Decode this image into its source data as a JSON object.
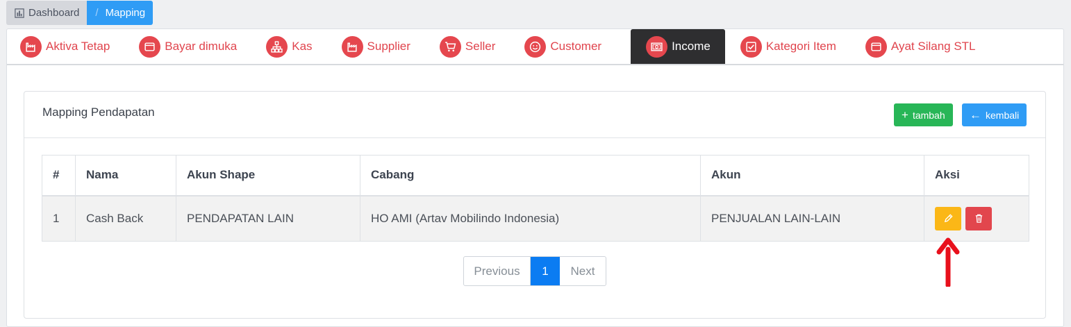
{
  "breadcrumb": {
    "home": "Dashboard",
    "separator": "/",
    "current": "Mapping"
  },
  "tabs": [
    {
      "label": "Aktiva Tetap",
      "icon": "factory-icon"
    },
    {
      "label": "Bayar dimuka",
      "icon": "wallet-icon"
    },
    {
      "label": "Kas",
      "icon": "sitemap-icon"
    },
    {
      "label": "Supplier",
      "icon": "factory-icon"
    },
    {
      "label": "Seller",
      "icon": "cart-icon"
    },
    {
      "label": "Customer",
      "icon": "smile-icon"
    },
    {
      "label": "Income",
      "icon": "money-icon",
      "active": true
    },
    {
      "label": "Kategori Item",
      "icon": "checkbox-icon"
    },
    {
      "label": "Ayat Silang STL",
      "icon": "wallet-icon"
    }
  ],
  "panel": {
    "title": "Mapping Pendapatan",
    "add_label": "tambah",
    "back_label": "kembali"
  },
  "table": {
    "headers": [
      "#",
      "Nama",
      "Akun Shape",
      "Cabang",
      "Akun",
      "Aksi"
    ],
    "rows": [
      {
        "no": "1",
        "nama": "Cash Back",
        "akun_shape": "PENDAPATAN LAIN",
        "cabang": "HO AMI (Artav Mobilindo Indonesia)",
        "akun": "PENJUALAN LAIN-LAIN"
      }
    ]
  },
  "pagination": {
    "prev": "Previous",
    "current": "1",
    "next": "Next"
  },
  "colors": {
    "tab_red": "#e0444d",
    "active_tab_bg": "#2e2e30",
    "add_green": "#28b657",
    "back_blue": "#2f9cf5",
    "edit_yellow": "#fbb717",
    "delete_red": "#e2464d",
    "annotation_arrow": "#e8101c"
  }
}
